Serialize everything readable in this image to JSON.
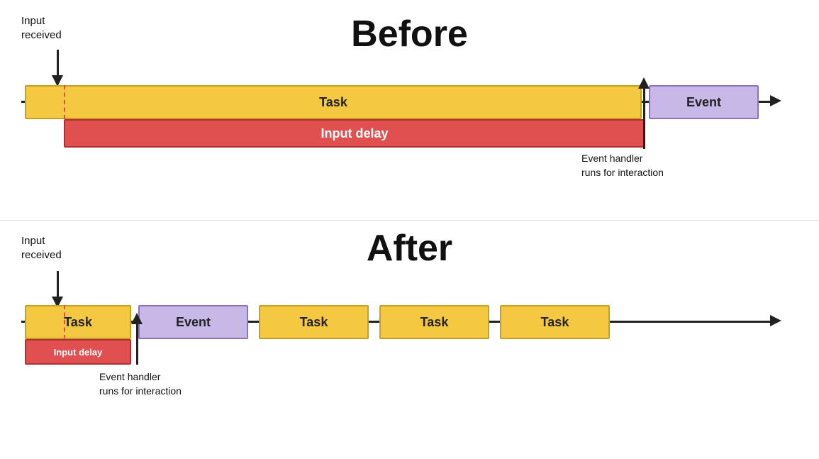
{
  "before": {
    "title": "Before",
    "input_received": "Input\nreceived",
    "task_label": "Task",
    "event_label": "Event",
    "input_delay_label": "Input delay",
    "event_handler_label": "Event handler\nruns for interaction"
  },
  "after": {
    "title": "After",
    "input_received": "Input\nreceived",
    "task_label": "Task",
    "event_label": "Event",
    "input_delay_label": "Input delay",
    "event_handler_label": "Event handler\nruns for interaction",
    "task2_label": "Task",
    "task3_label": "Task",
    "task4_label": "Task"
  }
}
